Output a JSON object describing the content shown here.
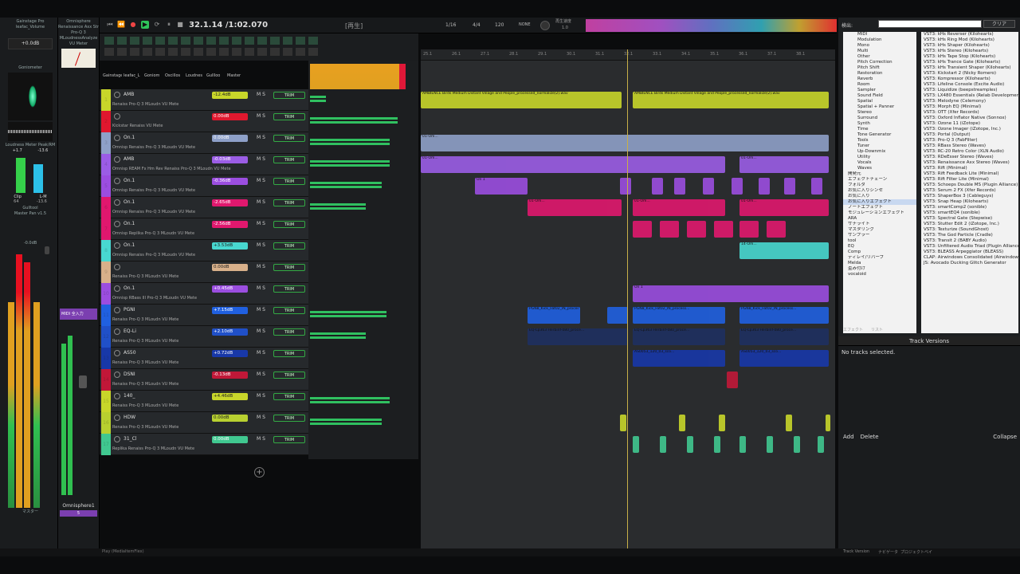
{
  "transport": {
    "position": "32.1.14 /1:02.070",
    "state": "[再生]",
    "meter": "1/16",
    "timesig": "4/4",
    "tempo": "120",
    "sync": "NONE",
    "playrate_label": "再生速度",
    "playrate": "1.0"
  },
  "left_mixer": {
    "fx_a": [
      "Gainstage Pro",
      "leafac_Volume"
    ],
    "gain": "+0.0dB",
    "goniometer": "Goniometer",
    "loudness": "Loudness Meter Peak/RM",
    "lvals": [
      "+1.7",
      "-13.6"
    ],
    "clip": "Clip",
    "lm": "L-M",
    "lnums": [
      "64",
      "-13.6"
    ],
    "guitool": "Gulltool",
    "masterfx": "Master Pan v1.5",
    "fader_val": "-0.0dB",
    "fx_b": [
      "Omnisphere",
      "Renaissance Axx Str",
      "Pro-Q 3",
      "MLoudnessAnalyze",
      "VU Meter"
    ],
    "vu": "VU Meter",
    "midi_label": "MIDI 全入力",
    "master_label": "マスター",
    "chan_name": "Omnisphere1",
    "chan_num": "5"
  },
  "master_fx": [
    "Gainstage",
    "leafac_L",
    "Goniom",
    "Oscillos",
    "Loudnes",
    "Gullloo",
    "Master"
  ],
  "tracks": [
    {
      "num": "1",
      "name": "AMB",
      "vol": "-12.4dB",
      "color": "#c8d62a",
      "fx": "Renaiss   Pro-Q 3   MLoudn   VU Mete"
    },
    {
      "num": "2",
      "name": "",
      "vol": "0.00dB",
      "color": "#e0182e",
      "fx": "Kickstar   Renaiss   VU Mete"
    },
    {
      "num": "3",
      "name": "On.1",
      "vol": "0.00dB",
      "color": "#8ea0c8",
      "fx": "Omnisp   Renaiss   Pro-Q 3   MLoudn   VU Mete"
    },
    {
      "num": "4",
      "name": "AMB",
      "vol": "-0.03dB",
      "color": "#9b5de5",
      "fx": "Omnisp   REAM Fx   Hm Rev   Renaiss   Pro-Q 3   MLoudn   VU Mete"
    },
    {
      "num": "5",
      "name": "On.1",
      "vol": "-0.36dB",
      "color": "#9b4ee0",
      "fx": "Omnisp   Renaiss   Pro-Q 3   MLoudn   VU Mete"
    },
    {
      "num": "6",
      "name": "On.1",
      "vol": "-2.65dB",
      "color": "#e0186e",
      "fx": "Omnisp   Renaiss   Pro-Q 3   MLoudn   VU Mete"
    },
    {
      "num": "7",
      "name": "On.1",
      "vol": "-2.56dB",
      "color": "#e0186e",
      "fx": "Omnisp   Replika   Pro-Q 3   MLoudn   VU Mete"
    },
    {
      "num": "8",
      "name": "On.1",
      "vol": "+3.53dB",
      "color": "#48d8d0",
      "fx": "Omnisp   Renaiss   Pro-Q 3   MLoudn   VU Mete"
    },
    {
      "num": "9",
      "name": "",
      "vol": "0.00dB",
      "color": "#d8b08a",
      "fx": "Renaiss   Pro-Q 3   MLoudn   VU Mete"
    },
    {
      "num": "10",
      "name": "On.1",
      "vol": "+0.45dB",
      "color": "#9b4ee0",
      "fx": "Omnisp   RBass III   Pro-Q 3   MLoudn   VU Mete"
    },
    {
      "num": "11",
      "name": "PGNI",
      "vol": "+7.15dB",
      "color": "#2060e0",
      "fx": "Renaiss   Pro-Q 3   MLoudn   VU Mete"
    },
    {
      "num": "12",
      "name": "EQ-Li",
      "vol": "+2.10dB",
      "color": "#2050c8",
      "fx": "Renaiss   Pro-Q 3   MLoudn   VU Mete"
    },
    {
      "num": "13",
      "name": "AS50",
      "vol": "+0.72dB",
      "color": "#1838a8",
      "fx": "Renaiss   Pro-Q 3   MLoudn   VU Mete"
    },
    {
      "num": "14",
      "name": "DSNI",
      "vol": "-0.13dB",
      "color": "#c01838",
      "fx": "Renaiss   Pro-Q 3   MLoudn   VU Mete"
    },
    {
      "num": "15",
      "name": "140_",
      "vol": "+4.46dB",
      "color": "#c8d62a",
      "fx": "Renaiss   Pro-Q 3   MLoudn   VU Mete"
    },
    {
      "num": "16",
      "name": "HDW",
      "vol": "0.00dB",
      "color": "#b8d030",
      "fx": "Renaiss   Pro-Q 3   MLoudn   VU Mete"
    },
    {
      "num": "17",
      "name": "31_Cl",
      "vol": "0.00dB",
      "color": "#40c890",
      "fx": "Replika   Renaiss   Pro-Q 3   MLoudn   VU Mete"
    }
  ],
  "ruler": [
    "25.1",
    "26.1",
    "27.1",
    "28.1",
    "29.1",
    "30.1",
    "31.1",
    "32.1",
    "33.1",
    "34.1",
    "35.1",
    "36.1",
    "37.1",
    "38.1"
  ],
  "clip_labels": {
    "amb": "AMBIENCE Birds Medium Distant Village and People_processed_normalize(2).wav",
    "omni": "01-Om...",
    "on": "On 1",
    "pgn": "PGN8_Kick_Fat02_IN_process...",
    "eq": "EQ-Lp363 Herbinf-080_proce...",
    "as": "AS0053_120_03_sco...",
    "c14": "14-Om..."
  },
  "browser": {
    "filter_label": "検出:",
    "clear_btn": "クリア",
    "tree": [
      "MIDI",
      "Modulation",
      "Mono",
      "Multi",
      "Other",
      "Pitch Correction",
      "Pitch Shift",
      "Restoration",
      "Reverb",
      "Room",
      "Sampler",
      "Sound Field",
      "Spatial",
      "Spatial + Panner",
      "Stereo",
      "Surround",
      "Synth",
      "Time",
      "Tone Generator",
      "Tools",
      "Tuner",
      "Up-Downmix",
      "Utility",
      "Vocals",
      "Waves",
      "開発元",
      "エフェクトチェーン",
      "フォルダ",
      "お気に入りシンセ",
      "お気に入り",
      "お気に入りエフェクト",
      "ノートエフェクト",
      "モジュレーションエフェクト",
      "ARA",
      "サチライト",
      "マスタリング",
      "サンプラー",
      "tool",
      "EQ",
      "Comp",
      "ディレイ/リバーブ",
      "Melda",
      "歪み付け",
      "vocaloid"
    ],
    "tree_selected": 30,
    "plugins": [
      "VST3: kHs Reverser (Kilohearts)",
      "VST3: kHs Ring Mod (Kilohearts)",
      "VST3: kHs Shaper (Kilohearts)",
      "VST3: kHs Stereo (Kilohearts)",
      "VST3: kHs Tape Stop (Kilohearts)",
      "VST3: kHs Trance Gate (Kilohearts)",
      "VST3: kHs Transient Shaper (Kilohearts)",
      "VST3: Kickstart 2 (Nicky Romero)",
      "VST3: Kompressor (Kilohearts)",
      "VST3: Lifeline Console (Excite Audio)",
      "VST3: Liquidize (beepstreamples)",
      "VST3: LX480 Essentials (Relab Development)",
      "VST3: Melodyne (Celemony)",
      "VST3: Morph EQ (Minimal)",
      "VST3: OTT (Xfer Records)",
      "VST3: Oxford Inflator Native (Sonnox)",
      "VST3: Ozone 11 (iZotope)",
      "VST3: Ozone Imager (iZotope, Inc.)",
      "VST3: Portal (Output)",
      "VST3: Pro-Q 3 (FabFilter)",
      "VST3: RBass Stereo (Waves)",
      "VST3: RC-20 Retro Color (XLN Audio)",
      "VST3: RDeEsser Stereo (Waves)",
      "VST3: Renaissance Axx Stereo (Waves)",
      "VST3: Rift (Minimal)",
      "VST3: Rift Feedback Lite (Minimal)",
      "VST3: Rift Filter Lite (Minimal)",
      "VST3: Schoeps Double MS (Plugin Alliance)",
      "VST3: Serum 2 FX (Xfer Records)",
      "VST3: ShaperBox 3 (Cableguys)",
      "VST3: Snap Heap (Kilohearts)",
      "VST3: smartComp2 (sonible)",
      "VST3: smartEQ4 (sonible)",
      "VST3: Spectral Gate (Stepwise)",
      "VST3: Stutter Edit 2 (iZotope, Inc.)",
      "VST3: Texturize (SoundGhost)",
      "VST3: The God Particle (Cradle)",
      "VST3: Transit 2 (BABY Audio)",
      "VST3: Unfiltered Audio Triad (Plugin Alliance)",
      "VST3: BLEASS Arpeggiator (BLEASS)",
      "CLAP: Airwindows Consolidated (Airwindows)",
      "JS: Avocado Ducking Glitch Generator"
    ],
    "tab1": "エフェクト",
    "tab2": "リスト"
  },
  "versions": {
    "title": "Track Versions",
    "empty": "No tracks selected.",
    "add": "Add",
    "delete": "Delete",
    "collapse": "Collapse"
  },
  "status": {
    "left": "Play (MediaItemFlex)",
    "tabs": [
      "Track Version",
      "ナビゲータ",
      "プロジェクトベイ"
    ]
  },
  "colors": {
    "accent_green": "#2fc45a",
    "playhead": "#c8b048"
  }
}
